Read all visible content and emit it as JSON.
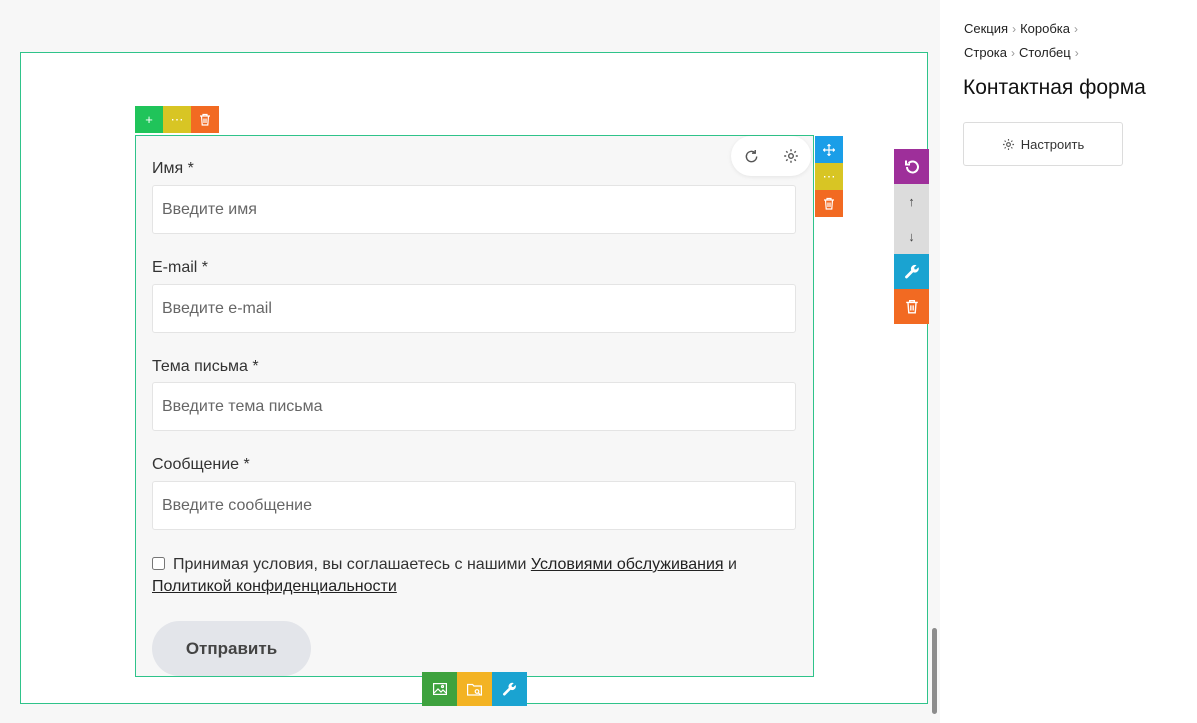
{
  "form": {
    "fields": [
      {
        "label": "Имя *",
        "placeholder": "Введите имя"
      },
      {
        "label": "E-mail *",
        "placeholder": "Введите e-mail"
      },
      {
        "label": "Тема письма *",
        "placeholder": "Введите тема письма"
      },
      {
        "label": "Сообщение *",
        "placeholder": "Введите сообщение"
      }
    ],
    "consent": {
      "text_before": "Принимая условия, вы соглашаетесь с нашими",
      "terms_link": "Условиями обслуживания",
      "and": "и",
      "privacy_link": "Политикой конфиденциальности"
    },
    "submit_label": "Отправить"
  },
  "toolbars": {
    "column_top": {
      "add": "+",
      "more": "⋯",
      "delete": "trash-icon"
    },
    "widget_side": {
      "move": "move-icon",
      "more": "⋯",
      "delete": "trash-icon"
    },
    "section_side": {
      "undo": "undo-icon",
      "up": "↑",
      "down": "↓",
      "settings": "wrench-icon",
      "delete": "trash-icon"
    },
    "bottom": {
      "image": "image-icon",
      "folder": "folder-icon",
      "settings": "wrench-icon"
    }
  },
  "panel": {
    "breadcrumb": [
      "Секция",
      "Коробка",
      "Строка",
      "Столбец"
    ],
    "title": "Контактная форма",
    "configure_label": "Настроить"
  },
  "colors": {
    "selection_border": "#2fc38a",
    "green": "#20c45a",
    "yellow": "#d8c524",
    "orange": "#f26a22",
    "blue": "#1a9ee8",
    "purple": "#9e2f9a"
  }
}
